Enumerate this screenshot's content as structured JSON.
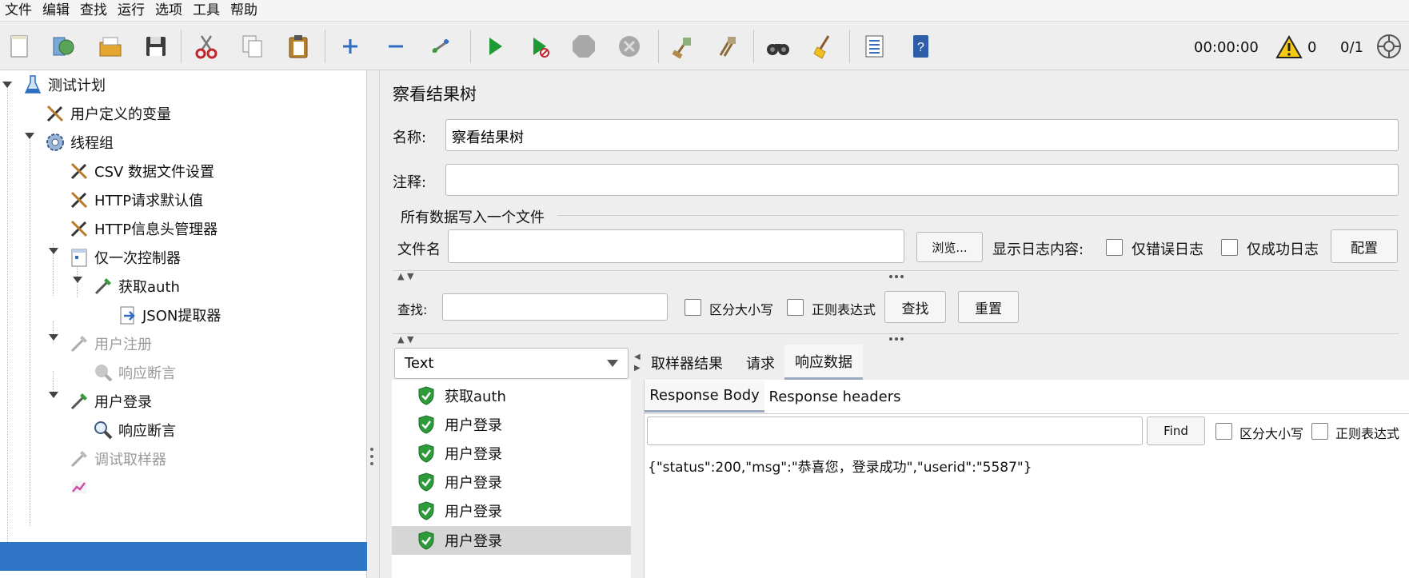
{
  "menu": [
    "文件",
    "编辑",
    "查找",
    "运行",
    "选项",
    "工具",
    "帮助"
  ],
  "toolbar": {
    "timer": "00:00:00",
    "warning_count": "0",
    "threads": "0/1"
  },
  "tree": {
    "nodes": [
      {
        "label": "测试计划"
      },
      {
        "label": "用户定义的变量"
      },
      {
        "label": "线程组"
      },
      {
        "label": "CSV 数据文件设置"
      },
      {
        "label": "HTTP请求默认值"
      },
      {
        "label": "HTTP信息头管理器"
      },
      {
        "label": "仅一次控制器"
      },
      {
        "label": "获取auth"
      },
      {
        "label": "JSON提取器"
      },
      {
        "label": "用户注册"
      },
      {
        "label": "响应断言"
      },
      {
        "label": "用户登录"
      },
      {
        "label": "响应断言"
      },
      {
        "label": "调试取样器"
      },
      {
        "label": "察看结果树"
      }
    ]
  },
  "panel": {
    "title": "察看结果树",
    "name_label": "名称:",
    "name_value": "察看结果树",
    "comment_label": "注释:",
    "comment_value": "",
    "group_title": "所有数据写入一个文件",
    "filename_label": "文件名",
    "filename_value": "",
    "browse_button": "浏览...",
    "log_content_label": "显示日志内容:",
    "errors_only_label": "仅错误日志",
    "success_only_label": "仅成功日志",
    "configure_button": "配置",
    "search_label": "查找:",
    "search_value": "",
    "case_sensitive_label": "区分大小写",
    "regex_label": "正则表达式",
    "find_button": "查找",
    "reset_button": "重置",
    "renderer_selected": "Text",
    "results": [
      {
        "label": "获取auth"
      },
      {
        "label": "用户登录"
      },
      {
        "label": "用户登录"
      },
      {
        "label": "用户登录"
      },
      {
        "label": "用户登录"
      },
      {
        "label": "用户登录"
      }
    ],
    "tabs": [
      "取样器结果",
      "请求",
      "响应数据"
    ],
    "subtabs": [
      "Response Body",
      "Response headers"
    ],
    "find_text_button": "Find",
    "find_value": "",
    "case_sensitive_label2": "区分大小写",
    "regex_label2": "正则表达式",
    "response_body": "{\"status\":200,\"msg\":\"恭喜您，登录成功\",\"userid\":\"5587\"}"
  },
  "colors": {
    "selection": "#2f77c6",
    "success_shield": "#2e9b3a"
  }
}
